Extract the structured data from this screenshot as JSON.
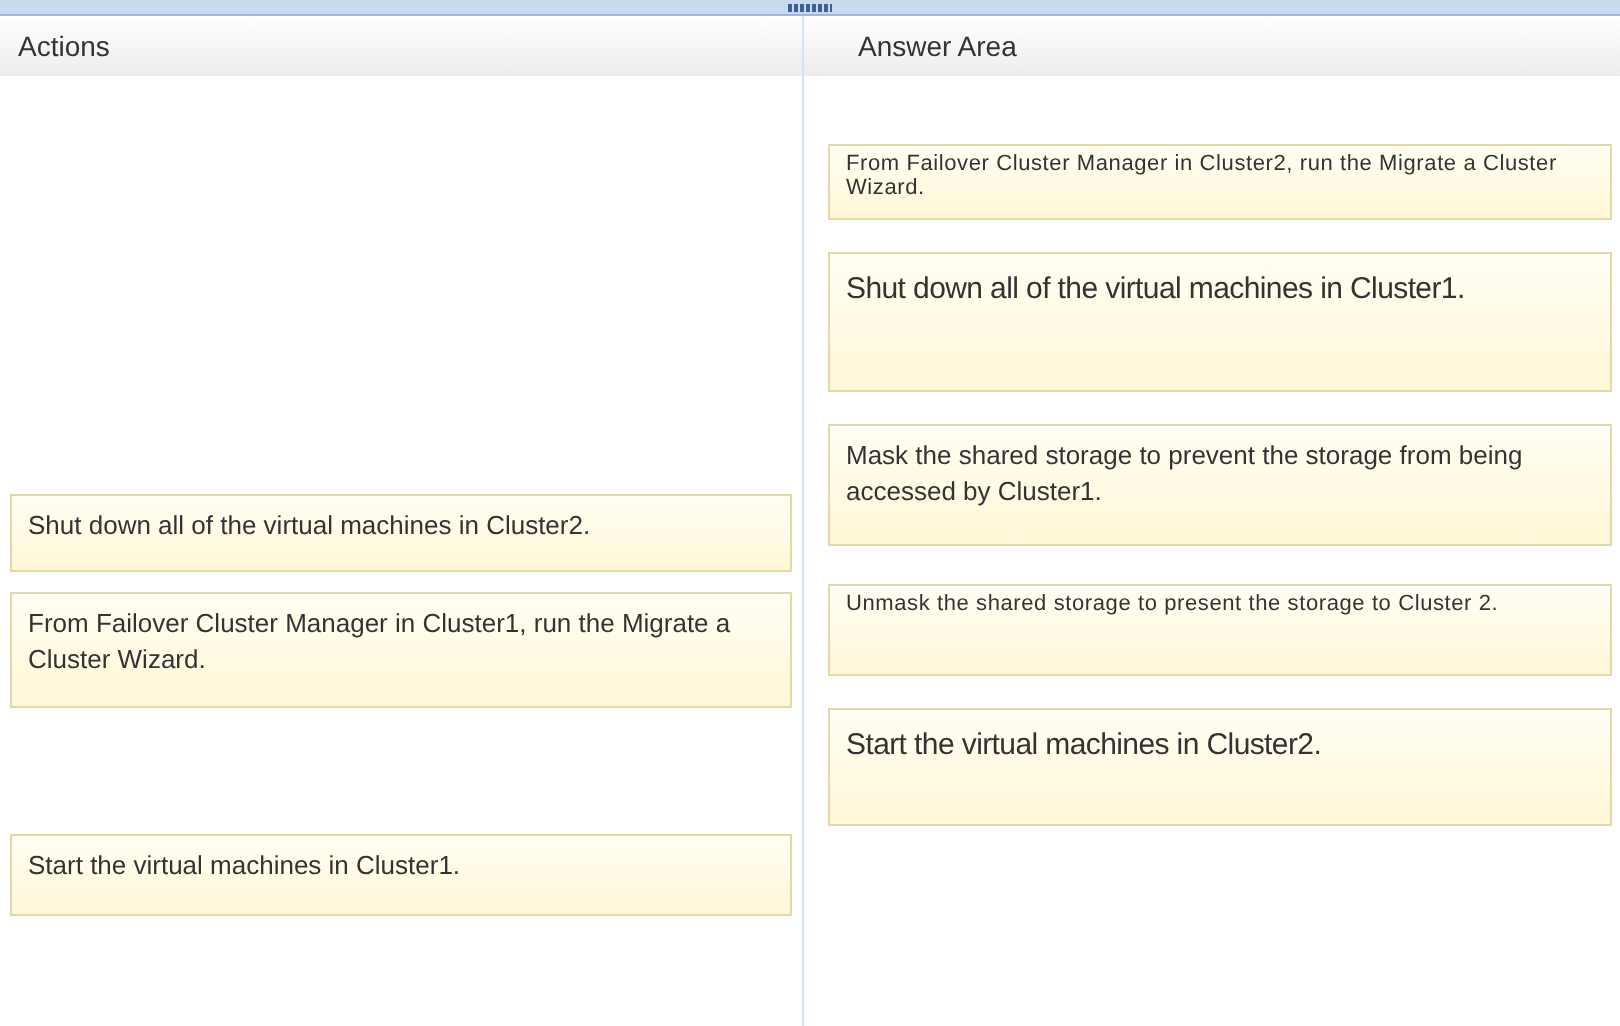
{
  "actions": {
    "title": "Actions",
    "items": [
      {
        "text": "Shut down all of the virtual machines in Cluster2.",
        "kind": "normal"
      },
      {
        "text": "From Failover Cluster Manager in Cluster1, run the Migrate a Cluster Wizard.",
        "kind": "normal"
      },
      {
        "text": "Start the virtual machines in Cluster1.",
        "kind": "normal"
      }
    ]
  },
  "answer_area": {
    "title": "Answer Area",
    "items": [
      {
        "text": "From Failover Cluster Manager in Cluster2, run the Migrate a Cluster Wizard.",
        "kind": "small"
      },
      {
        "text": "Shut down all of the virtual machines in Cluster1.",
        "kind": "large"
      },
      {
        "text": "Mask the shared storage to prevent the storage from being accessed by Cluster1.",
        "kind": "normal"
      },
      {
        "text": "Unmask the shared storage to present the storage to Cluster 2.",
        "kind": "small"
      },
      {
        "text": "Start the virtual machines in Cluster2.",
        "kind": "large"
      }
    ]
  }
}
